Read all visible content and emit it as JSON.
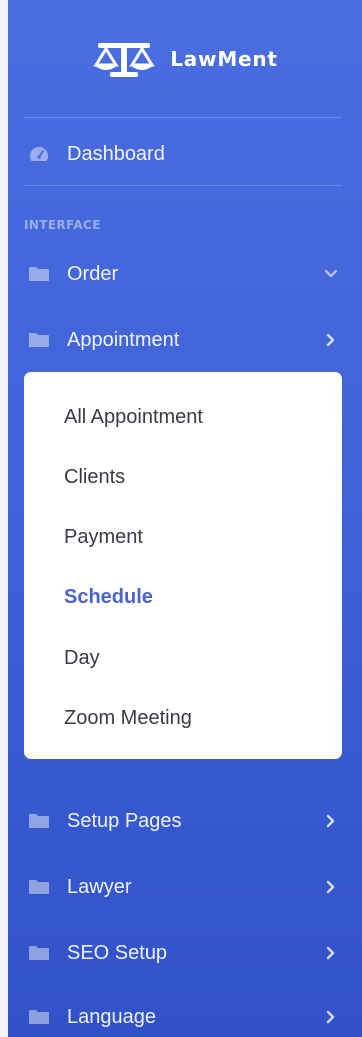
{
  "brand": {
    "name": "LawMent",
    "logo_icon": "scales-of-justice-icon"
  },
  "nav": {
    "dashboard": {
      "label": "Dashboard",
      "icon": "tachometer-icon"
    },
    "section_heading": "INTERFACE",
    "items": [
      {
        "label": "Order",
        "icon": "folder-icon",
        "chevron": "chevron-down-icon"
      },
      {
        "label": "Appointment",
        "icon": "folder-icon",
        "chevron": "chevron-right-icon"
      },
      {
        "label": "Setup Pages",
        "icon": "folder-icon",
        "chevron": "chevron-right-icon"
      },
      {
        "label": "Lawyer",
        "icon": "folder-icon",
        "chevron": "chevron-right-icon"
      },
      {
        "label": "SEO Setup",
        "icon": "folder-icon",
        "chevron": "chevron-right-icon"
      },
      {
        "label": "Language",
        "icon": "folder-icon",
        "chevron": "chevron-right-icon"
      }
    ]
  },
  "appointment_submenu": {
    "items": [
      {
        "label": "All Appointment",
        "active": false
      },
      {
        "label": "Clients",
        "active": false
      },
      {
        "label": "Payment",
        "active": false
      },
      {
        "label": "Schedule",
        "active": true
      },
      {
        "label": "Day",
        "active": false
      },
      {
        "label": "Zoom Meeting",
        "active": false
      }
    ]
  },
  "colors": {
    "sidebar_top": "#4a6ee0",
    "sidebar_bottom": "#3152c8",
    "active_submenu_text": "#4a63d4",
    "submenu_text": "#3a3b45"
  }
}
